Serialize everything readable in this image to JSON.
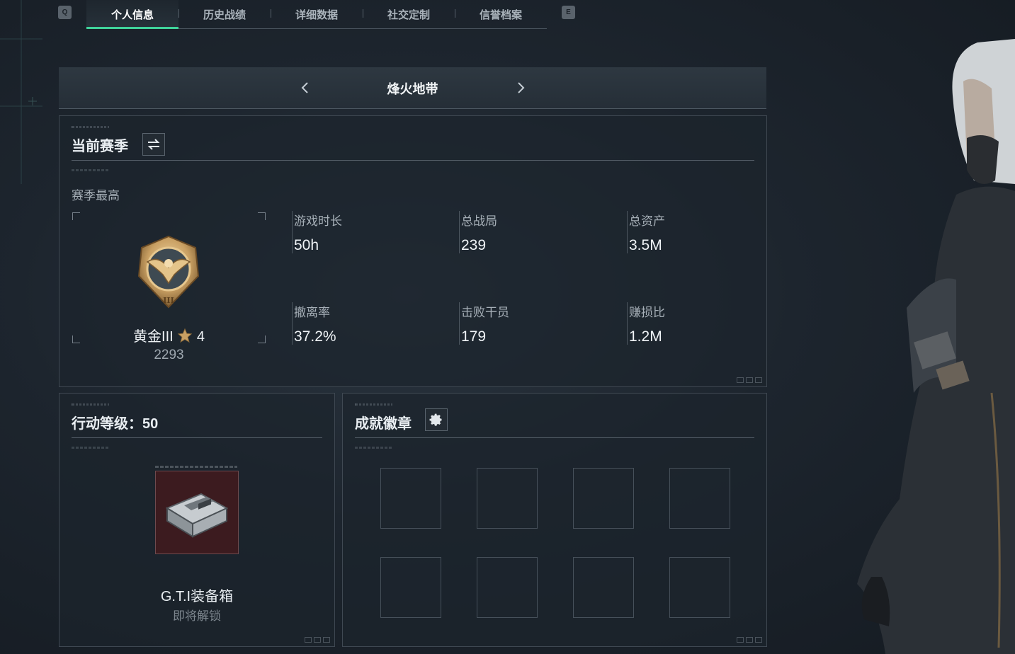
{
  "tabbar": {
    "left_key": "Q",
    "right_key": "E",
    "tabs": [
      {
        "label": "个人信息",
        "active": true
      },
      {
        "label": "历史战绩",
        "active": false
      },
      {
        "label": "详细数据",
        "active": false
      },
      {
        "label": "社交定制",
        "active": false
      },
      {
        "label": "信誉档案",
        "active": false
      }
    ]
  },
  "mode_selector": {
    "title": "烽火地带",
    "prev_icon": "chevron-left-icon",
    "next_icon": "chevron-right-icon"
  },
  "season_panel": {
    "title": "当前赛季",
    "switch_icon": "swap-icon",
    "subtitle": "赛季最高",
    "rank": {
      "name": "黄金III",
      "stars": "4",
      "score": "2293",
      "emblem_icon": "gold-eagle-rank-emblem"
    },
    "stats": [
      {
        "label": "游戏时长",
        "value": "50h"
      },
      {
        "label": "总战局",
        "value": "239"
      },
      {
        "label": "总资产",
        "value": "3.5M"
      },
      {
        "label": "撤离率",
        "value": "37.2%"
      },
      {
        "label": "击败干员",
        "value": "179"
      },
      {
        "label": "赚损比",
        "value": "1.2M"
      }
    ]
  },
  "level_panel": {
    "title": "行动等级：50",
    "reward": {
      "name": "G.T.I装备箱",
      "status": "即将解锁",
      "icon": "equipment-case-icon"
    }
  },
  "badge_panel": {
    "title": "成就徽章",
    "settings_icon": "gear-icon",
    "slot_count": 8
  },
  "colors": {
    "accent": "#3fd29a",
    "background": "#1d252e",
    "panel_border": "#3f4852",
    "gold": "#c9a063",
    "reward_bg": "#3c1b1f"
  }
}
